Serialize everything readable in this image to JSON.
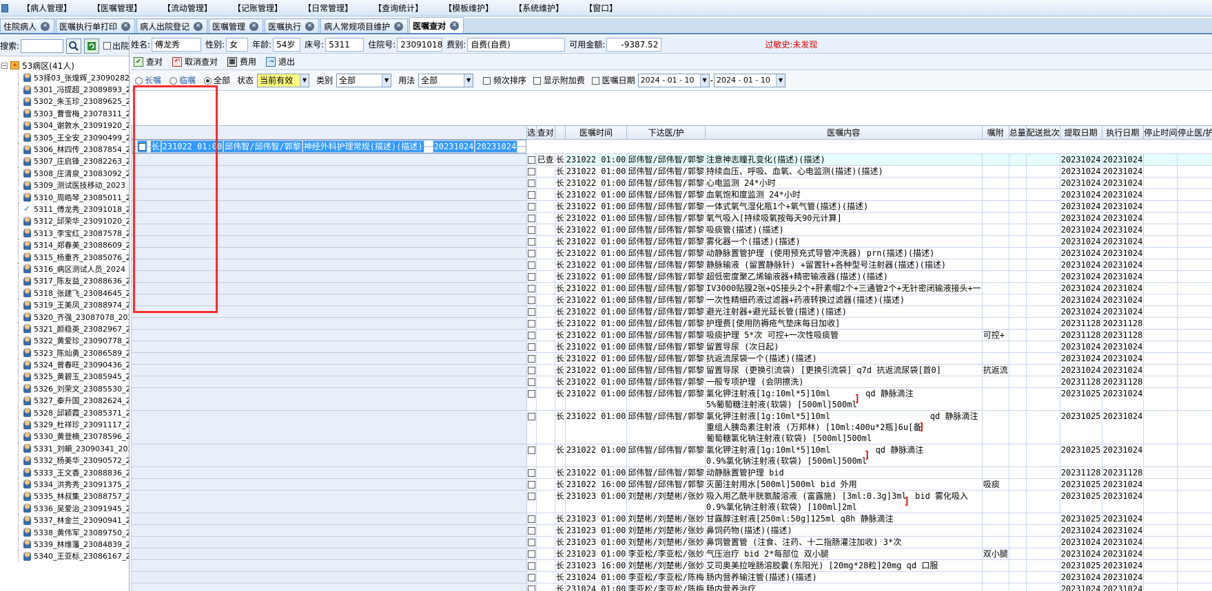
{
  "menu": [
    "【病人管理】",
    "【医嘱管理】",
    "【流动管理】",
    "【记账管理】",
    "【日常管理】",
    "【查询统计】",
    "【模板维护】",
    "【系统维护】",
    "【窗口】"
  ],
  "tabs": [
    {
      "label": "住院病人",
      "active": false
    },
    {
      "label": "医嘱执行单打印",
      "active": false
    },
    {
      "label": "病人出院登记",
      "active": false
    },
    {
      "label": "医嘱管理",
      "active": false
    },
    {
      "label": "医嘱执行",
      "active": false
    },
    {
      "label": "病人常规项目维护",
      "active": false
    },
    {
      "label": "医嘱查对",
      "active": true
    }
  ],
  "search": {
    "label": "搜索:",
    "value": "",
    "out_label": "出院"
  },
  "tree": {
    "root": "53病区(41人)",
    "patients": [
      "53择03_张煌辉_23090282",
      "5301_冯提超_23089893_2",
      "5302_朱玉珍_23089625_2",
      "5303_曹雪梅_23078311_2",
      "5304_谢敦水_23091920_2",
      "5305_王全安_23090499_2",
      "5306_林四传_23087854_2",
      "5307_庄启锋_23082263_2",
      "5308_庄清泉_23083092_2",
      "5309_测试医技移动_2023",
      "5310_周皓琴_23085011_2",
      "5311_傅龙秀_23091018_2",
      "5312_邱荣华_23091020_2",
      "5313_李宝红_23087578_2",
      "5314_郑春美_23088609_2",
      "5315_杨重齐_23085076_2",
      "5316_病区测试人员_2024",
      "5317_陈友益_23088636_2",
      "5318_张建飞_23084645_2",
      "5319_王美凤_23088974_2",
      "5320_齐强_23087078_202",
      "5321_颜稳英_23082967_2",
      "5322_黄爱珍_23090778_2",
      "5323_陈灿勇_23086589_2",
      "5324_曾春旺_23090436_2",
      "5325_黄碧玉_23085945_2",
      "5326_刘荣文_23085530_2",
      "5327_秦升国_23082624_2",
      "5328_邱颖霞_23085371_2",
      "5329_杜祥珍_23091117_2",
      "5330_黄登楠_23078596_2",
      "5331_刘頔_23090341_202",
      "5332_杨美华_23090572_2",
      "5333_王文香_23088836_2",
      "5334_洪秀秀_23091375_2",
      "5335_林叔集_23088757_2",
      "5336_吴爱治_23091945_2",
      "5337_林金兰_23090941_2",
      "5338_黄伟军_23089750_2",
      "5339_林维藩_23084839_2",
      "5340_王亚标_23086167_2"
    ],
    "selected_index": 11
  },
  "patient": {
    "name_label": "姓名:",
    "name": "傅龙秀",
    "sex_label": "性别:",
    "sex": "女",
    "age_label": "年龄:",
    "age": "54岁",
    "bed_label": "床号:",
    "bed": "5311",
    "admit_label": "住院号:",
    "admit": "23091018",
    "fee_label": "费别:",
    "fee": "自费(自费)",
    "balance_label": "可用金额:",
    "balance": "-9387.52",
    "allergy": "过敏史:未发现"
  },
  "toolbar": {
    "check": "查对",
    "cancel": "取消查对",
    "fee": "费用",
    "exit": "退出"
  },
  "filters": {
    "long": "长嘱",
    "temp": "临嘱",
    "all": "全部",
    "status_label": "状态",
    "status": "当前有效",
    "type_label": "类别",
    "type": "全部",
    "usage_label": "用法",
    "usage": "全部",
    "freq_sort": "频次排序",
    "show_extra": "显示附加费",
    "date_label": "医嘱日期",
    "date_from": "2024 - 01 - 10",
    "date_to": "2024 - 01 - 10"
  },
  "columns": [
    "选",
    "查对",
    "",
    "医嘱时间",
    "下达医/护",
    "医嘱内容",
    "嘱附",
    "总量",
    "配送批次",
    "提取日期",
    "执行日期",
    "停止时间",
    "停止医/护"
  ],
  "rows": [
    {
      "chk": "",
      "type": "长",
      "time": "231022 01:00",
      "doc": "邱伟智/邱伟智/郭黎",
      "content": [
        "神经外科护理常规(描述)(描述)"
      ],
      "note": "",
      "get": "20231024",
      "exec": "20231024",
      "sel": true
    },
    {
      "chk": "已查",
      "type": "长",
      "time": "231022 01:00",
      "doc": "邱伟智/邱伟智/郭黎",
      "content": [
        "注意神志瞳孔变化(描述)(描述)"
      ],
      "note": "",
      "get": "20231024",
      "exec": "20231024",
      "alt": true
    },
    {
      "chk": "",
      "type": "长",
      "time": "231022 01:00",
      "doc": "邱伟智/邱伟智/郭黎",
      "content": [
        "持续血压、呼吸、血氧、心电监测(描述)(描述)"
      ],
      "note": "",
      "get": "20231024",
      "exec": "20231024"
    },
    {
      "chk": "",
      "type": "长",
      "time": "231022 01:00",
      "doc": "邱伟智/邱伟智/郭黎",
      "content": [
        "心电监测  24*小时"
      ],
      "note": "",
      "get": "20231024",
      "exec": "20231024"
    },
    {
      "chk": "",
      "type": "长",
      "time": "231022 01:00",
      "doc": "邱伟智/邱伟智/郭黎",
      "content": [
        "血氧饱和度监测  24*小时"
      ],
      "note": "",
      "get": "20231024",
      "exec": "20231024"
    },
    {
      "chk": "",
      "type": "长",
      "time": "231022 01:00",
      "doc": "邱伟智/邱伟智/郭黎",
      "content": [
        "一体式氧气湿化瓶1个+氧气管(描述)(描述)"
      ],
      "note": "",
      "get": "20231024",
      "exec": "20231024"
    },
    {
      "chk": "",
      "type": "长",
      "time": "231022 01:00",
      "doc": "邱伟智/邱伟智/郭黎",
      "content": [
        "氧气吸入[持续吸氧按每天90元计算]"
      ],
      "note": "",
      "get": "20231024",
      "exec": "20231024"
    },
    {
      "chk": "",
      "type": "长",
      "time": "231022 01:00",
      "doc": "邱伟智/邱伟智/郭黎",
      "content": [
        "吸痰管(描述)(描述)"
      ],
      "note": "",
      "get": "20231024",
      "exec": "20231024"
    },
    {
      "chk": "",
      "type": "长",
      "time": "231022 01:00",
      "doc": "邱伟智/邱伟智/郭黎",
      "content": [
        "雾化器一个(描述)(描述)"
      ],
      "note": "",
      "get": "20231024",
      "exec": "20231024"
    },
    {
      "chk": "",
      "type": "长",
      "time": "231022 01:00",
      "doc": "邱伟智/邱伟智/郭黎",
      "content": [
        "动静脉置管护理 (使用预充式导管冲洗器) prn(描述)(描述)"
      ],
      "note": "",
      "get": "20231024",
      "exec": "20231024"
    },
    {
      "chk": "",
      "type": "长",
      "time": "231022 01:00",
      "doc": "邱伟智/邱伟智/郭黎",
      "content": [
        "静脉输液 (留置静脉针) +留置针+各种型号注射器(描述)(描述)"
      ],
      "note": "",
      "get": "20231024",
      "exec": "20231024"
    },
    {
      "chk": "",
      "type": "长",
      "time": "231022 01:00",
      "doc": "邱伟智/邱伟智/郭黎",
      "content": [
        "超低密度聚乙烯输液器+精密输液器(描述)(描述)"
      ],
      "note": "",
      "get": "20231024",
      "exec": "20231024"
    },
    {
      "chk": "",
      "type": "长",
      "time": "231022 01:00",
      "doc": "邱伟智/邱伟智/郭黎",
      "content": [
        "IV3000贴膜2张+QS接头2个+肝素帽2个+三通管2个+无针密闭输液接头+一"
      ],
      "note": "",
      "get": "20231024",
      "exec": "20231024"
    },
    {
      "chk": "",
      "type": "长",
      "time": "231022 01:00",
      "doc": "邱伟智/邱伟智/郭黎",
      "content": [
        "一次性精细药液过滤器+药液转换过滤器(描述)(描述)"
      ],
      "note": "",
      "get": "20231024",
      "exec": "20231024"
    },
    {
      "chk": "",
      "type": "长",
      "time": "231022 01:00",
      "doc": "邱伟智/邱伟智/郭黎",
      "content": [
        "避光注射器+避光延长管(描述)(描述)"
      ],
      "note": "",
      "get": "20231024",
      "exec": "20231024"
    },
    {
      "chk": "",
      "type": "长",
      "time": "231022 01:00",
      "doc": "邱伟智/邱伟智/郭黎",
      "content": [
        "护理费[使用防褥疮气垫床每日加收]"
      ],
      "note": "",
      "get": "20231128",
      "exec": "20231128"
    },
    {
      "chk": "",
      "type": "长",
      "time": "231022 01:00",
      "doc": "邱伟智/邱伟智/郭黎",
      "content": [
        "吸痰护理  5*次 可控+一次性吸痰管"
      ],
      "note": "可控+",
      "get": "20231128",
      "exec": "20231128"
    },
    {
      "chk": "",
      "type": "长",
      "time": "231022 01:00",
      "doc": "邱伟智/邱伟智/郭黎",
      "content": [
        "留置导尿 (次日起)"
      ],
      "note": "",
      "get": "20231024",
      "exec": "20231024"
    },
    {
      "chk": "",
      "type": "长",
      "time": "231022 01:00",
      "doc": "邱伟智/邱伟智/郭黎",
      "content": [
        "抗返流尿袋一个(描述)(描述)"
      ],
      "note": "",
      "get": "20231024",
      "exec": "20231024"
    },
    {
      "chk": "",
      "type": "长",
      "time": "231022 01:00",
      "doc": "邱伟智/邱伟智/郭黎",
      "content": [
        "留置导尿 (更换引流袋) [更换引流袋] q7d  抗返流尿袋[首0]"
      ],
      "note": "抗返流",
      "get": "20231024",
      "exec": "20231024"
    },
    {
      "chk": "",
      "type": "长",
      "time": "231022 01:00",
      "doc": "邱伟智/邱伟智/郭黎",
      "content": [
        "一般专项护理 (会阴擦洗)"
      ],
      "note": "",
      "get": "20231128",
      "exec": "20231128"
    },
    {
      "chk": "",
      "type": "长",
      "time": "231022 01:00",
      "doc": "邱伟智/邱伟智/郭黎",
      "content": [
        "氯化钾注射液[1g:10ml*5]10ml",
        "5%葡萄糖注射液(软袋) [500ml]500ml"
      ],
      "group": "qd 静脉滴注",
      "note": "",
      "get": "20231025",
      "exec": "20231024"
    },
    {
      "chk": "",
      "type": "长",
      "time": "231022 01:00",
      "doc": "邱伟智/邱伟智/郭黎",
      "content": [
        "氯化钾注射液[1g:10ml*5]10ml",
        "重组人胰岛素注射液 (万邦林) [10ml:400u*2瓶]6u[备",
        "葡萄糖氯化钠注射液(软袋) [500ml]500ml"
      ],
      "group": "qd 静脉滴注",
      "note": "",
      "get": "20231025",
      "exec": "20231024"
    },
    {
      "chk": "",
      "type": "长",
      "time": "231022 01:00",
      "doc": "邱伟智/邱伟智/郭黎",
      "content": [
        "氯化钾注射液[1g:10ml*5]10ml",
        "0.9%氯化钠注射液(软袋) [500ml]500ml"
      ],
      "group": "qd 静脉滴注",
      "note": "",
      "get": "20231025",
      "exec": "20231024"
    },
    {
      "chk": "",
      "type": "长",
      "time": "231022 01:00",
      "doc": "邱伟智/邱伟智/郭黎",
      "content": [
        "动静脉置管护理 bid"
      ],
      "note": "",
      "get": "20231128",
      "exec": "20231128"
    },
    {
      "chk": "",
      "type": "长",
      "time": "231022 16:00",
      "doc": "邱伟智/邱伟智/郭黎",
      "content": [
        "灭菌注射用水[500ml]500ml bid 外用"
      ],
      "note": "吸痰",
      "get": "20231025",
      "exec": "20231024"
    },
    {
      "chk": "",
      "type": "长",
      "time": "231023 01:00",
      "doc": "刘楚彬/刘楚彬/张妙",
      "content": [
        "吸入用乙酰半胱氨酸溶液 (富露施) [3ml:0.3g]3ml",
        "0.9%氯化钠注射液(软袋) [100ml]2ml"
      ],
      "group": "bid 雾化吸入",
      "note": "",
      "get": "20231025",
      "exec": "20231024"
    },
    {
      "chk": "",
      "type": "长",
      "time": "231023 01:00",
      "doc": "刘楚彬/刘楚彬/张妙",
      "content": [
        "甘露醇注射液[250ml:50g]125ml q8h 静脉滴注"
      ],
      "note": "",
      "get": "20231025",
      "exec": "20231024"
    },
    {
      "chk": "",
      "type": "长",
      "time": "231023 01:00",
      "doc": "刘楚彬/刘楚彬/张妙",
      "content": [
        "鼻饲药物(描述)(描述)"
      ],
      "note": "",
      "get": "20231024",
      "exec": "20231024"
    },
    {
      "chk": "",
      "type": "长",
      "time": "231023 01:00",
      "doc": "刘楚彬/刘楚彬/张妙",
      "content": [
        "鼻饲管置管 (注食、注药、十二指肠灌注加收)  3*次"
      ],
      "note": "",
      "get": "20231024",
      "exec": "20231024"
    },
    {
      "chk": "",
      "type": "长",
      "time": "231023 01:00",
      "doc": "李亚松/李亚松/张妙",
      "content": [
        "气压治疗 bid 2*每部位 双小腿"
      ],
      "note": "双小腿",
      "get": "20231024",
      "exec": "20231024"
    },
    {
      "chk": "",
      "type": "长",
      "time": "231023 16:00",
      "doc": "刘楚彬/刘楚彬/张妙",
      "content": [
        "艾司奥美拉唑肠溶胶囊(东阳光) [20mg*28粒]20mg qd 口服"
      ],
      "note": "",
      "get": "20231025",
      "exec": "20231024"
    },
    {
      "chk": "",
      "type": "长",
      "time": "231024 01:00",
      "doc": "李亚松/李亚松/陈梅",
      "content": [
        "肠内营养输注管(描述)(描述)"
      ],
      "note": "",
      "get": "20231024",
      "exec": "20231024"
    },
    {
      "chk": "",
      "type": "长",
      "time": "231024 01:00",
      "doc": "李亚松/李亚松/陈梅",
      "content": [
        "肠内营养治疗"
      ],
      "note": "",
      "get": "20231024",
      "exec": "20231024"
    }
  ]
}
